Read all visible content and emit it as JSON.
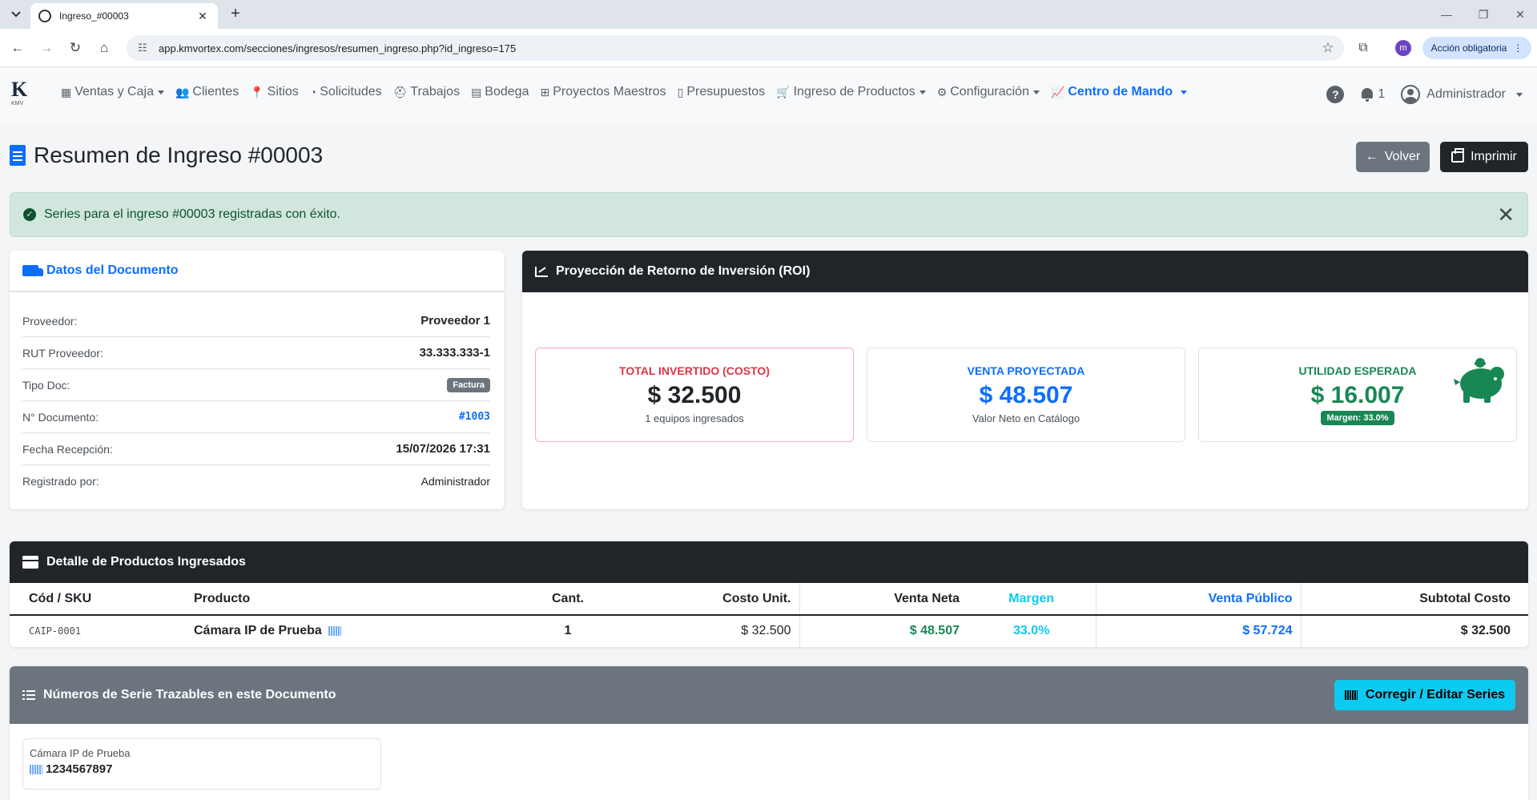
{
  "browser": {
    "tab_title": "Ingreso_#00003",
    "url": "app.kmvortex.com/secciones/ingresos/resumen_ingreso.php?id_ingreso=175",
    "profile_initial": "m",
    "action_pill": "Acción obligatoria"
  },
  "nav": {
    "logo_sub": "KMV",
    "items": [
      {
        "label": "Ventas y Caja",
        "icon": "cash-register-icon",
        "dropdown": true
      },
      {
        "label": "Clientes",
        "icon": "users-icon",
        "dropdown": false
      },
      {
        "label": "Sitios",
        "icon": "map-marker-icon",
        "dropdown": false
      },
      {
        "label": "Solicitudes",
        "icon": "satellite-dish-icon",
        "dropdown": false
      },
      {
        "label": "Trabajos",
        "icon": "hard-hat-icon",
        "dropdown": false
      },
      {
        "label": "Bodega",
        "icon": "boxes-icon",
        "dropdown": false
      },
      {
        "label": "Proyectos Maestros",
        "icon": "sitemap-icon",
        "dropdown": false
      },
      {
        "label": "Presupuestos",
        "icon": "invoice-icon",
        "dropdown": false
      },
      {
        "label": "Ingreso de Productos",
        "icon": "cart-icon",
        "dropdown": true
      },
      {
        "label": "Configuración",
        "icon": "gear-icon",
        "dropdown": true
      },
      {
        "label": "Centro de Mando",
        "icon": "chart-line-icon",
        "dropdown": true,
        "active": true
      }
    ],
    "notifications_count": "1",
    "user_label": "Administrador"
  },
  "page": {
    "title": "Resumen de Ingreso #00003",
    "back_label": "Volver",
    "print_label": "Imprimir"
  },
  "alert": {
    "message": "Series para el ingreso #00003 registradas con éxito."
  },
  "doc_data": {
    "title": "Datos del Documento",
    "rows": [
      {
        "label": "Proveedor:",
        "value": "Proveedor 1"
      },
      {
        "label": "RUT Proveedor:",
        "value": "33.333.333-1"
      },
      {
        "label": "Tipo Doc:",
        "value": "Factura"
      },
      {
        "label": "N° Documento:",
        "value": "#1003"
      },
      {
        "label": "Fecha Recepción:",
        "value": "15/07/2026 17:31"
      },
      {
        "label": "Registrado por:",
        "value": "Administrador"
      }
    ]
  },
  "roi": {
    "title": "Proyección de Retorno de Inversión (ROI)",
    "invested": {
      "label": "TOTAL INVERTIDO (COSTO)",
      "value": "$ 32.500",
      "sub": "1 equipos ingresados"
    },
    "projected": {
      "label": "VENTA PROYECTADA",
      "value": "$ 48.507",
      "sub": "Valor Neto en Catálogo"
    },
    "profit": {
      "label": "UTILIDAD ESPERADA",
      "value": "$ 16.007",
      "badge": "Margen: 33.0%"
    }
  },
  "products": {
    "title": "Detalle de Productos Ingresados",
    "headers": [
      "Cód / SKU",
      "Producto",
      "Cant.",
      "Costo Unit.",
      "Venta Neta",
      "Margen",
      "Venta Público",
      "Subtotal Costo"
    ],
    "rows": [
      {
        "sku": "CAIP-0001",
        "product": "Cámara IP de Prueba",
        "qty": "1",
        "unit_cost": "$ 32.500",
        "net_sale": "$ 48.507",
        "margin": "33.0%",
        "public_sale": "$ 57.724",
        "subtotal": "$ 32.500"
      }
    ]
  },
  "series": {
    "title": "Números de Serie Trazables en este Documento",
    "edit_label": "Corregir / Editar Series",
    "items": [
      {
        "product": "Cámara IP de Prueba",
        "serial": "1234567897"
      }
    ]
  },
  "colors": {
    "primary": "#0d6efd",
    "success": "#198754",
    "danger": "#dc3545",
    "info": "#0dcaf0",
    "dark": "#212529",
    "secondary": "#6c757d"
  }
}
